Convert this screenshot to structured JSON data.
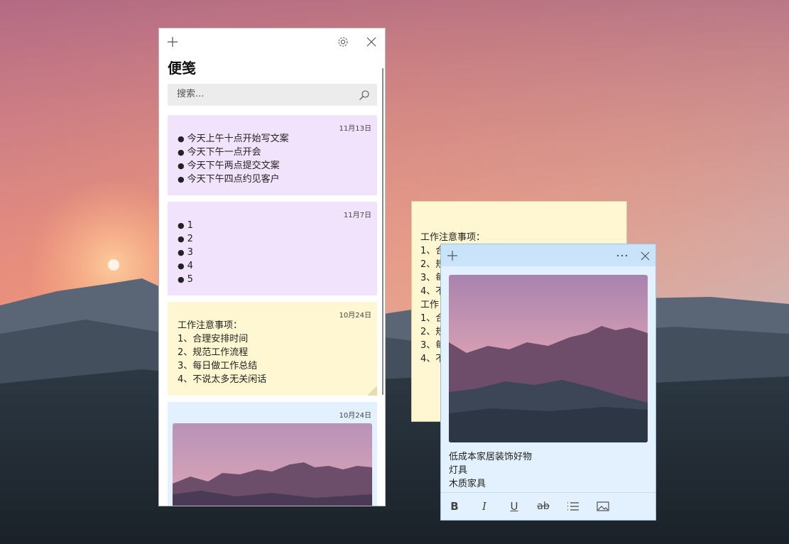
{
  "app": {
    "title": "便笺",
    "search_placeholder": "搜索...",
    "icons": {
      "add": "plus-icon",
      "settings": "gear-icon",
      "close": "close-icon",
      "search": "search-icon"
    }
  },
  "notes": [
    {
      "date": "11月13日",
      "color": "#f1e3fc",
      "items": [
        "今天上午十点开始写文案",
        "今天下午一点开会",
        "今天下午两点提交文案",
        "今天下午四点约见客户"
      ]
    },
    {
      "date": "11月7日",
      "color": "#f1e3fc",
      "items": [
        "1",
        "2",
        "3",
        "4",
        "5"
      ]
    },
    {
      "date": "10月24日",
      "color": "#fff7d1",
      "lines": [
        "工作注意事项：",
        "1、合理安排时间",
        "2、规范工作流程",
        "3、每日做工作总结",
        "4、不说太多无关闲话"
      ]
    },
    {
      "date": "10月24日",
      "color": "#e2f1fd"
    }
  ],
  "yellow_note": {
    "lines": [
      "工作注意事项：",
      "1、合",
      "2、规",
      "3、每",
      "4、不",
      "工作",
      "1、合",
      "2、规",
      "3、每",
      "4、不"
    ]
  },
  "blue_note": {
    "lines": [
      "低成本家居装饰好物",
      "灯具",
      "木质家具"
    ],
    "toolbar": {
      "bold": "B",
      "italic": "I",
      "underline": "U",
      "strike": "ab"
    }
  }
}
